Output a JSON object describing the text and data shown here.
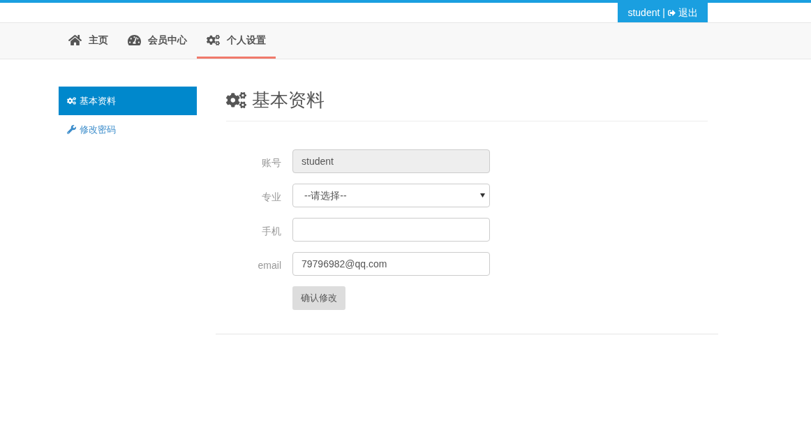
{
  "user_bar": {
    "username": "student",
    "separator": "|",
    "logout": "退出"
  },
  "nav": [
    {
      "label": "主页",
      "selected": false
    },
    {
      "label": "会员中心",
      "selected": false
    },
    {
      "label": "个人设置",
      "selected": true
    }
  ],
  "sidebar": {
    "items": [
      {
        "label": "基本资料",
        "selected": true
      },
      {
        "label": "修改密码",
        "selected": false
      }
    ]
  },
  "page_title": "基本资料",
  "form": {
    "fields": [
      {
        "label": "账号",
        "kind": "input",
        "value": "student",
        "disabled": true
      },
      {
        "label": "专业",
        "kind": "select",
        "value": "--请选择--",
        "disabled": false
      },
      {
        "label": "手机",
        "kind": "input",
        "disabled": false
      },
      {
        "label": "email",
        "kind": "input",
        "value": "79796982@qq.com",
        "disabled": false
      }
    ],
    "submit": "确认修改"
  }
}
